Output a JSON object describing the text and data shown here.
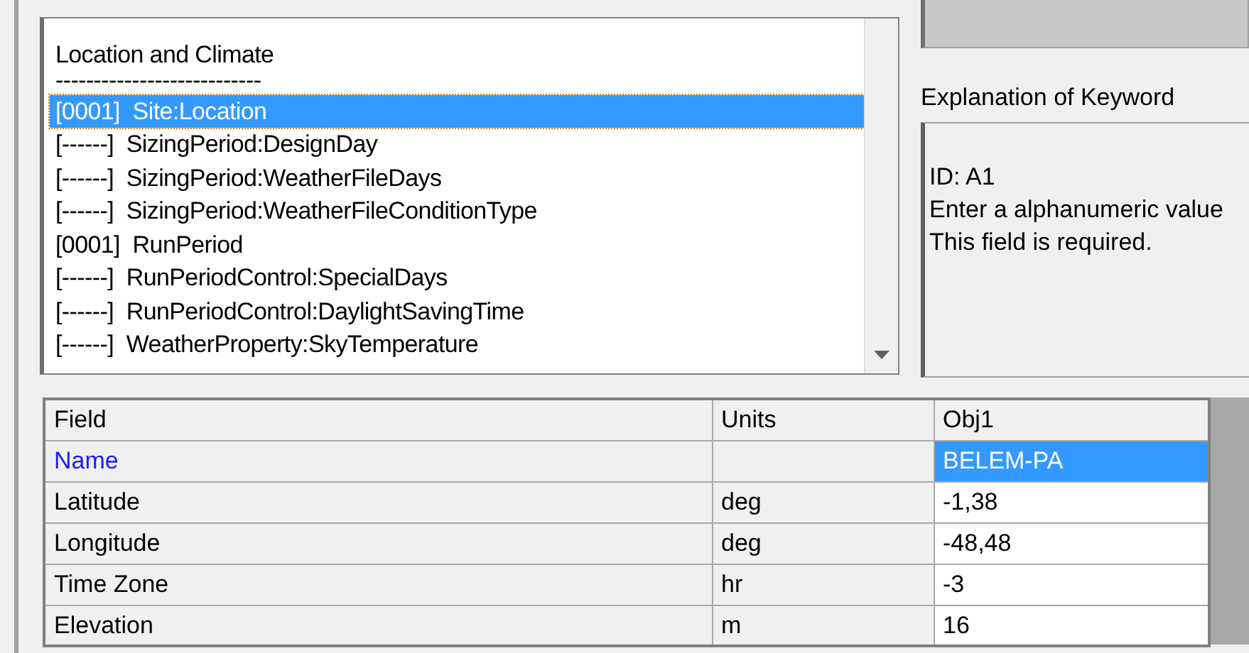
{
  "class_list": {
    "items": [
      {
        "text": "Location and Climate",
        "kind": "group",
        "selected": false
      },
      {
        "text": "---------------------------",
        "kind": "separator",
        "selected": false
      },
      {
        "text": "[0001]  Site:Location",
        "kind": "class",
        "selected": true
      },
      {
        "text": "[------]  SizingPeriod:DesignDay",
        "kind": "class",
        "selected": false
      },
      {
        "text": "[------]  SizingPeriod:WeatherFileDays",
        "kind": "class",
        "selected": false
      },
      {
        "text": "[------]  SizingPeriod:WeatherFileConditionType",
        "kind": "class",
        "selected": false
      },
      {
        "text": "[0001]  RunPeriod",
        "kind": "class",
        "selected": false
      },
      {
        "text": "[------]  RunPeriodControl:SpecialDays",
        "kind": "class",
        "selected": false
      },
      {
        "text": "[------]  RunPeriodControl:DaylightSavingTime",
        "kind": "class",
        "selected": false
      },
      {
        "text": "[------]  WeatherProperty:SkyTemperature",
        "kind": "class",
        "selected": false
      }
    ]
  },
  "explanation": {
    "label": "Explanation of Keyword",
    "lines": [
      "ID: A1",
      "Enter a alphanumeric value",
      "This field is required."
    ]
  },
  "table": {
    "columns": [
      "Field",
      "Units",
      "Obj1"
    ],
    "rows": [
      {
        "field": "Name",
        "units": "",
        "value": "BELEM-PA",
        "required": true,
        "selected": true
      },
      {
        "field": "Latitude",
        "units": "deg",
        "value": "-1,38",
        "required": false,
        "selected": false
      },
      {
        "field": "Longitude",
        "units": "deg",
        "value": "-48,48",
        "required": false,
        "selected": false
      },
      {
        "field": "Time Zone",
        "units": "hr",
        "value": "-3",
        "required": false,
        "selected": false
      },
      {
        "field": "Elevation",
        "units": "m",
        "value": "16",
        "required": false,
        "selected": false
      }
    ]
  }
}
